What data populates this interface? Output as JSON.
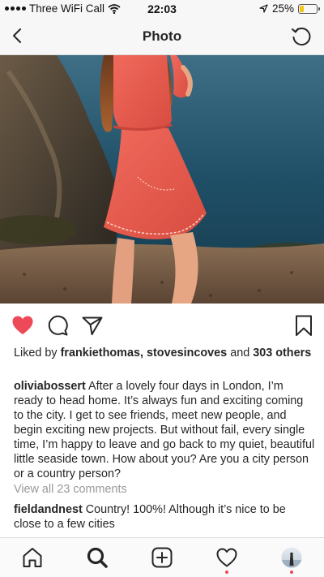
{
  "status_bar": {
    "carrier": "Three WiFi Call",
    "time": "22:03",
    "battery": "25%",
    "battery_level": 0.25
  },
  "nav": {
    "title": "Photo",
    "back_icon": "chevron-left-icon",
    "refresh_icon": "refresh-icon"
  },
  "post": {
    "liked": true,
    "like_color": "#ed4956",
    "likes": {
      "prefix": "Liked by",
      "user1": "frankiethomas",
      "separator": ",",
      "user2": "stovesincoves",
      "middle": "and",
      "count_line": "303 others"
    },
    "caption": {
      "username": "oliviabossert",
      "text": "After a lovely four days in London, I’m ready to head home. It’s always fun and exciting coming to the city. I get to see friends, meet new people, and begin exciting new projects. But without fail, every single time, I’m happy to leave and go back to my quiet, beautiful little seaside town. How about you? Are you a city person or a country person?"
    },
    "view_comments": "View all 23 comments",
    "comment": {
      "username": "fieldandnest",
      "text": "Country! 100%! Although it’s nice to be close to a few cities"
    }
  },
  "tab_bar": {
    "items": [
      "home-icon",
      "search-icon",
      "new-post-icon",
      "activity-icon",
      "profile-avatar"
    ],
    "notification_color": "#ed4956"
  }
}
